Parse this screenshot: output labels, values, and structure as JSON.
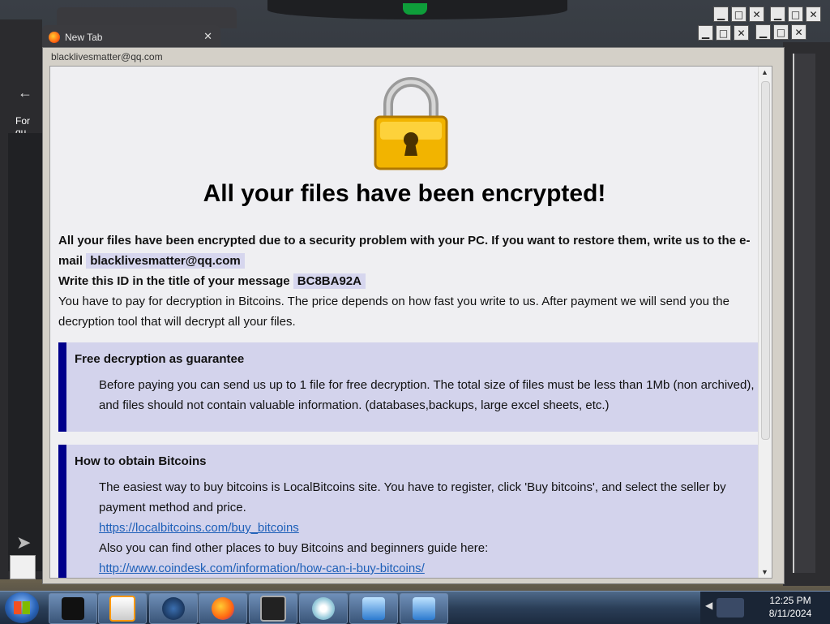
{
  "background_windows": {
    "tab_label": "New Tab",
    "sidebar_text": "For qu"
  },
  "dialog": {
    "title": "blacklivesmatter@qq.com",
    "heading": "All your files have been encrypted!",
    "para1_text": "All your files have been encrypted due to a security problem with your PC. If you want to restore them, write us to the e-mail ",
    "para1_email": "blacklivesmatter@qq.com",
    "para2_text": "Write this ID in the title of your message ",
    "para2_id": "BC8BA92A",
    "para3": "You have to pay for decryption in Bitcoins. The price depends on how fast you write to us. After payment we will send you the decryption tool that will decrypt all your files.",
    "box1": {
      "heading": "Free decryption as guarantee",
      "text": "Before paying you can send us up to 1 file for free decryption. The total size of files must be less than 1Mb (non archived), and files should not contain valuable information. (databases,backups, large excel sheets, etc.)"
    },
    "box2": {
      "heading": "How to obtain Bitcoins",
      "text1": "The easiest way to buy bitcoins is LocalBitcoins site. You have to register, click 'Buy bitcoins', and select the seller by payment method and price.",
      "link1": "https://localbitcoins.com/buy_bitcoins",
      "text2": "Also you can find other places to buy Bitcoins and beginners guide here:",
      "link2": "http://www.coindesk.com/information/how-can-i-buy-bitcoins/"
    }
  },
  "window_buttons": {
    "minimize": "▁",
    "maximize": "□",
    "close": "✕"
  },
  "taskbar": {
    "time": "12:25 PM",
    "date": "8/11/2024",
    "icons": [
      "terminal-icon",
      "media-player-icon",
      "globe-icon",
      "firefox-icon",
      "monitor-icon",
      "disc-icon",
      "network-icon",
      "network-icon"
    ],
    "colors": {
      "taskbar": "#2b3f58",
      "accent_box": "#d3d3ec",
      "accent_bar": "#00008b",
      "link": "#1d5fb8"
    }
  }
}
